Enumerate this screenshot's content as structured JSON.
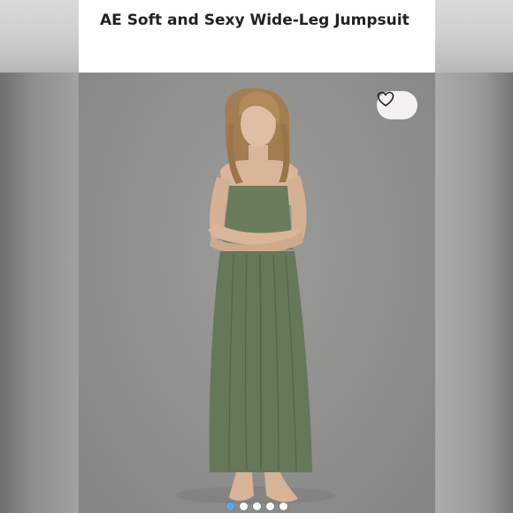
{
  "product": {
    "title": "AE Soft and Sexy Wide-Leg Jumpsuit"
  },
  "photo": {
    "icon": "woman-in-jumpsuit-photo",
    "jumpsuit_color": "#6b7c5c",
    "backdrop_color": "#8f8f8e"
  },
  "favorite": {
    "icon": "heart-icon"
  },
  "carousel": {
    "total": 5,
    "active_index": 0,
    "active_color": "#5aa9e6"
  }
}
